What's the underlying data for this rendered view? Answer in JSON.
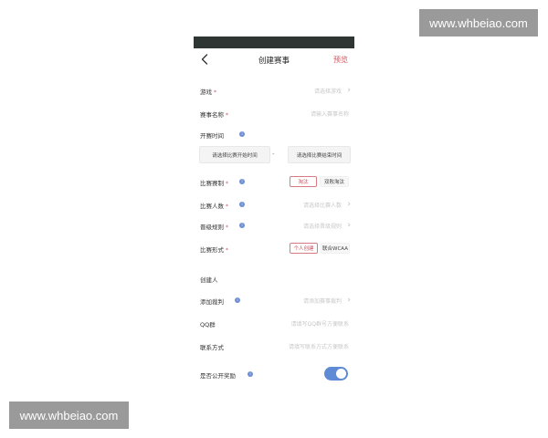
{
  "watermark": {
    "text": "www.whbeiao.com"
  },
  "header": {
    "title": "创建赛事",
    "preview_label": "预览"
  },
  "form": {
    "game": {
      "label": "游戏",
      "required": "*",
      "value": "请选择游戏"
    },
    "name": {
      "label": "赛事名称",
      "required": "*",
      "value": "请输入赛事名称"
    },
    "start_time": {
      "label": "开赛时间",
      "start_placeholder": "请选择比赛开始时间",
      "separator": "-",
      "end_placeholder": "请选择比赛结束时间"
    },
    "format": {
      "label": "比赛赛制",
      "required": "*",
      "options": [
        "淘汰",
        "双败淘汰"
      ],
      "selected": "淘汰"
    },
    "players": {
      "label": "比赛人数",
      "required": "*",
      "value": "请选择比赛人数"
    },
    "advance": {
      "label": "晋级规则",
      "required": "*",
      "value": "请选择晋级规则"
    },
    "style": {
      "label": "比赛形式",
      "required": "*",
      "options": [
        "个人创建",
        "联合WCAA"
      ],
      "selected": "个人创建"
    },
    "creator": {
      "label": "创建人"
    },
    "referee": {
      "label": "添加裁判",
      "value": "请添加赛事裁判"
    },
    "qq": {
      "label": "QQ群",
      "value": "请填写QQ群号方便联系"
    },
    "contact": {
      "label": "联系方式",
      "value": "请填写联系方式方便联系"
    },
    "public_reward": {
      "label": "是否公开奖励",
      "enabled": true
    }
  },
  "colors": {
    "accent": "#d2525b",
    "toggle": "#5f8ad6",
    "status_bar": "#2f3533"
  }
}
